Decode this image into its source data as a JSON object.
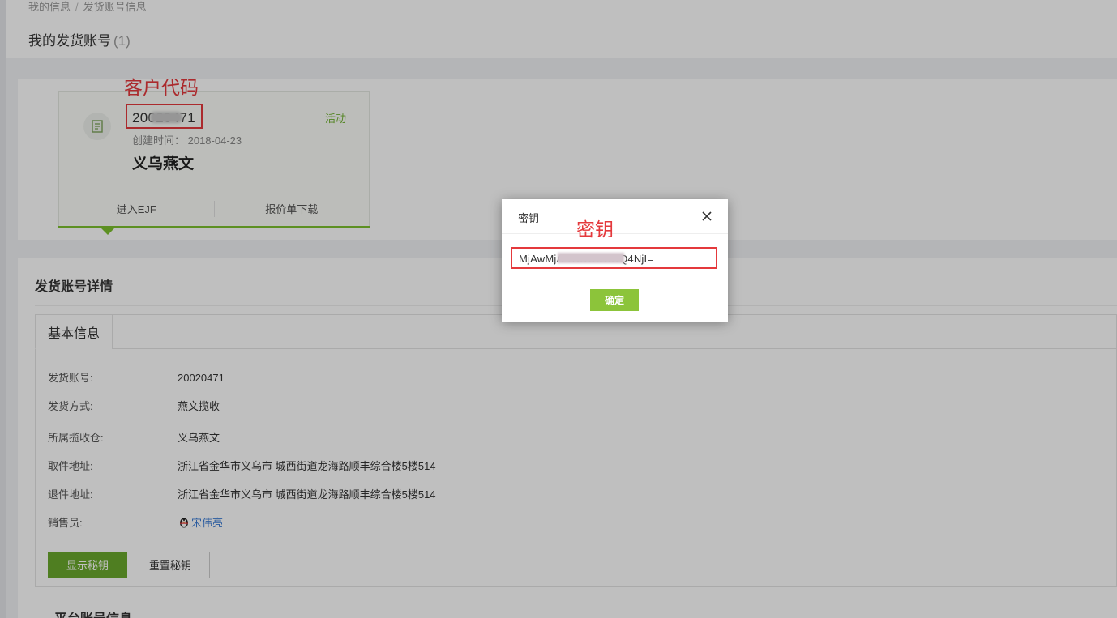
{
  "breadcrumb": {
    "items": [
      "我的信息",
      "发货账号信息"
    ],
    "separator": "/"
  },
  "page": {
    "title": "我的发货账号",
    "count": "(1)"
  },
  "annotations": {
    "client_code": "客户代码",
    "key": "密钥"
  },
  "account_card": {
    "code": "20020471",
    "status": "活动",
    "created": "创建时间：  2018-04-23",
    "name": "义乌燕文",
    "actions": [
      "进入EJF",
      "报价单下载"
    ]
  },
  "details": {
    "section_title": "发货账号详情",
    "tab": "基本信息",
    "rows": [
      {
        "label": "发货账号:",
        "value": "20020471"
      },
      {
        "label": "发货方式:",
        "value": "燕文揽收"
      },
      {
        "label": "所属揽收仓:",
        "value": "义乌燕文"
      },
      {
        "label": "取件地址:",
        "value": "浙江省金华市义乌市 城西街道龙海路顺丰综合楼5楼514"
      },
      {
        "label": "退件地址:",
        "value": "浙江省金华市义乌市 城西街道龙海路顺丰综合楼5楼514"
      },
      {
        "label": "销售员:",
        "value": "宋伟亮"
      }
    ],
    "show_secret_label": "显示秘钥",
    "reset_secret_label": "重置秘钥",
    "platform_title": "平台账号信息"
  },
  "modal": {
    "title": "密钥",
    "key_value": "MjAwMjA              1NDUwODQ4NjI=",
    "ok_label": "确定"
  },
  "colors": {
    "accent_green": "#7cc12e",
    "annotation_red": "#e4393c",
    "link_blue": "#3a7bd5"
  }
}
